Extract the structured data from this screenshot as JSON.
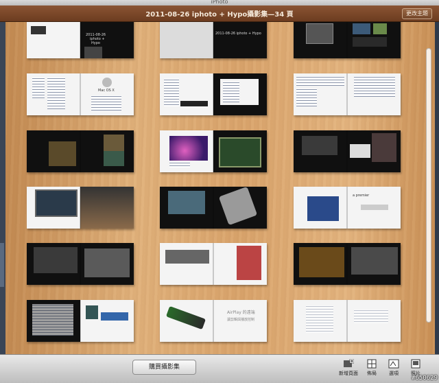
{
  "window": {
    "title": "iPhoto"
  },
  "header": {
    "book_title": "2011-08-26 iphoto + Hypo攝影集—34 頁",
    "theme_button": "更改主題"
  },
  "spreads": {
    "r0c1_text": "2011-08-26 iphoto + Hypo",
    "r1c0_text": "Mac OS X"
  },
  "r5": {
    "airplay_text": "AirPlay 的遠端",
    "airplay_text2": "讓剪輯與播放控制",
    "premier_text": "a premier"
  },
  "toolbar": {
    "buy_button": "購買攝影集",
    "add_page_label": "新增頁面",
    "layout_label": "佈局",
    "options_label": "選項",
    "photos_label": "照片"
  },
  "watermark": "#650629"
}
